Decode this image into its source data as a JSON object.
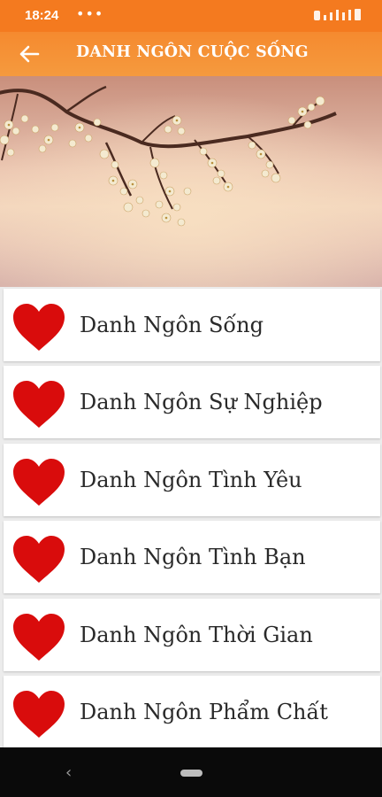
{
  "status": {
    "time": "18:24",
    "dots": "•••"
  },
  "appbar": {
    "title": "DANH NGÔN CUỘC SỐNG",
    "back_icon": "arrow-left-icon"
  },
  "items": [
    {
      "label": "Danh Ngôn Sống",
      "icon": "heart-icon"
    },
    {
      "label": "Danh Ngôn Sự Nghiệp",
      "icon": "heart-icon"
    },
    {
      "label": "Danh Ngôn Tình Yêu",
      "icon": "heart-icon"
    },
    {
      "label": "Danh Ngôn Tình Bạn",
      "icon": "heart-icon"
    },
    {
      "label": "Danh Ngôn Thời Gian",
      "icon": "heart-icon"
    },
    {
      "label": "Danh Ngôn Phẩm Chất",
      "icon": "heart-icon"
    }
  ],
  "colors": {
    "accent": "#f47a1f",
    "heart": "#d90c0c",
    "navbar": "#0a0a0a"
  }
}
